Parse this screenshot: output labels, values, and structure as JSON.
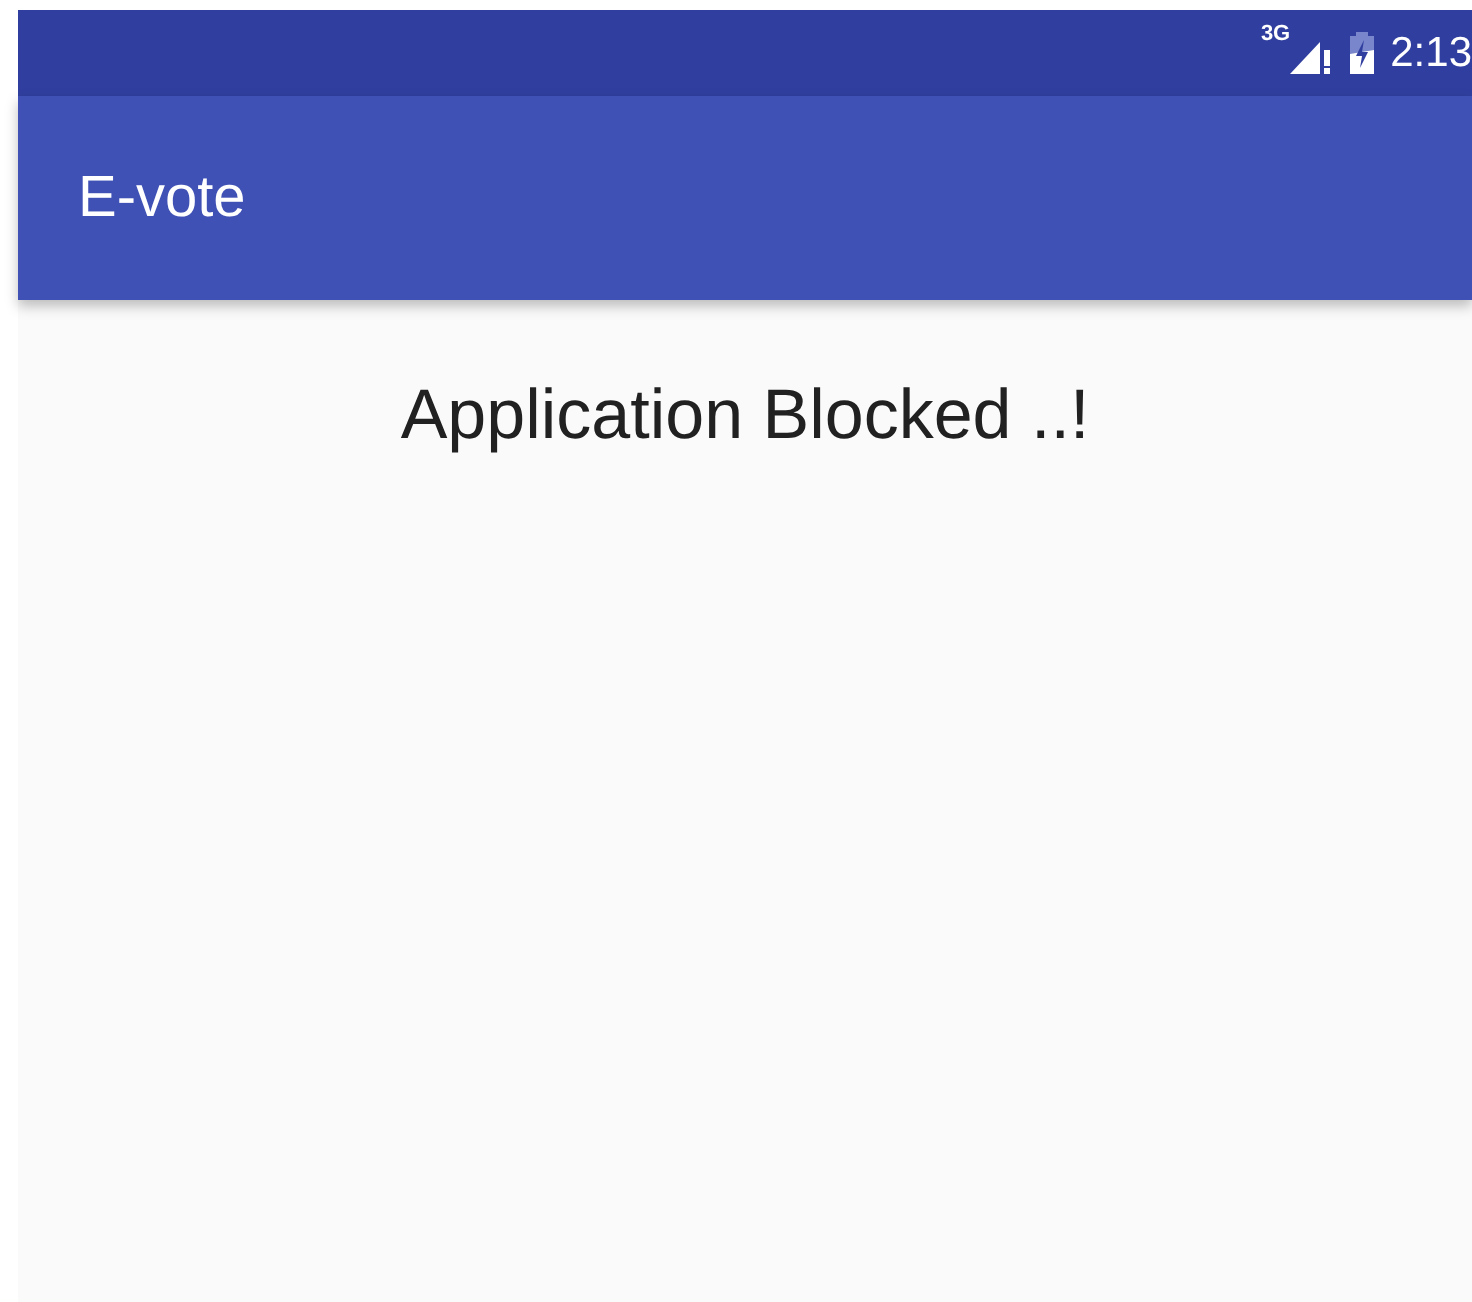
{
  "status_bar": {
    "network": "3G",
    "time": "2:13"
  },
  "app_bar": {
    "title": "E-vote"
  },
  "message": "Application Blocked ..!"
}
